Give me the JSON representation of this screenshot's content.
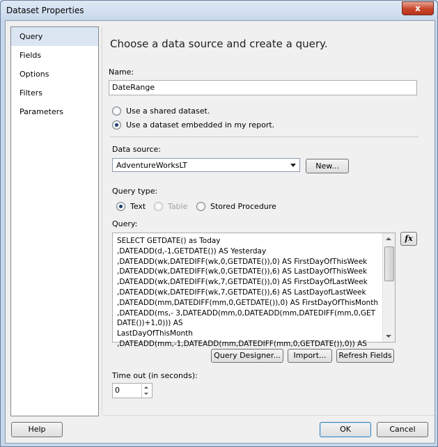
{
  "window": {
    "title": "Dataset Properties",
    "close_label": "x"
  },
  "nav": {
    "items": [
      "Query",
      "Fields",
      "Options",
      "Filters",
      "Parameters"
    ],
    "selected": "Query"
  },
  "main": {
    "heading": "Choose a data source and create a query.",
    "name_label": "Name:",
    "name_value": "DateRange",
    "radio_shared": "Use a shared dataset.",
    "radio_embedded": "Use a dataset embedded in my report.",
    "datasource_label": "Data source:",
    "datasource_value": "AdventureWorksLT",
    "new_button": "New...",
    "querytype_label": "Query type:",
    "querytype_text": "Text",
    "querytype_table": "Table",
    "querytype_sp": "Stored Procedure",
    "query_label": "Query:",
    "query_text": "SELECT GETDATE() as Today\n,DATEADD(d,-1,GETDATE()) AS Yesterday\n,DATEADD(wk,DATEDIFF(wk,0,GETDATE()),0) AS FirstDayOfThisWeek\n,DATEADD(wk,DATEDIFF(wk,0,GETDATE()),6) AS LastDayOfThisWeek\n,DATEADD(wk,DATEDIFF(wk,7,GETDATE()),0) AS FirstDayOfLastWeek\n,DATEADD(wk,DATEDIFF(wk,7,GETDATE()),6) AS LastDayofLastWeek\n,DATEADD(mm,DATEDIFF(mm,0,GETDATE()),0) AS FirstDayOfThisMonth\n,DATEADD(ms,- 3,DATEADD(mm,0,DATEADD(mm,DATEDIFF(mm,0,GETDATE())+1,0))) AS\nLastDayOfThisMonth\n,DATEADD(mm,-1,DATEADD(mm,DATEDIFF(mm,0,GETDATE()),0)) AS",
    "fx_label": "fx",
    "query_designer_button": "Query Designer...",
    "import_button": "Import...",
    "refresh_fields_button": "Refresh Fields",
    "timeout_label": "Time out (in seconds):",
    "timeout_value": "0"
  },
  "footer": {
    "help": "Help",
    "ok": "OK",
    "cancel": "Cancel"
  }
}
